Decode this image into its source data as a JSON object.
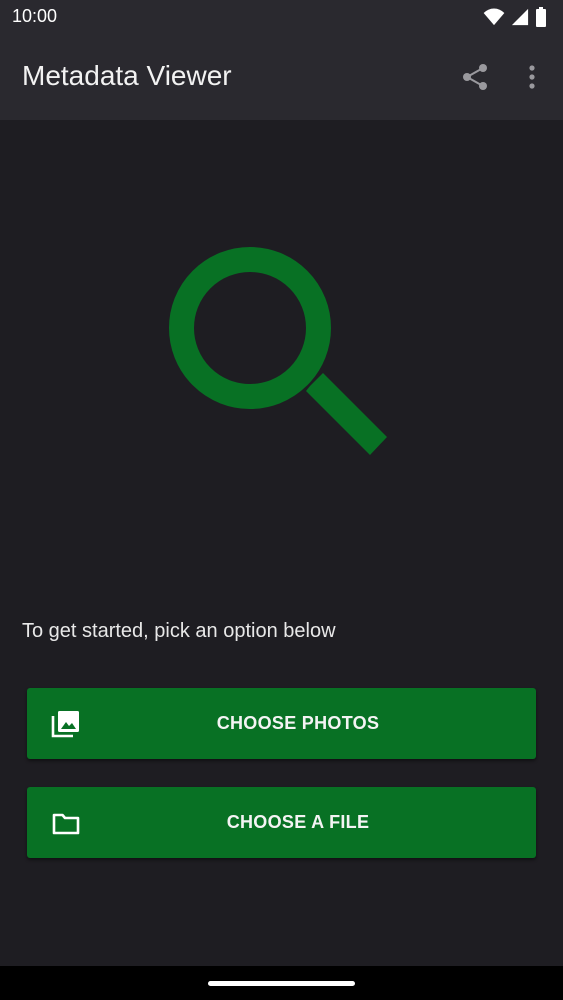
{
  "status_bar": {
    "time": "10:00",
    "icons": [
      "wifi-icon",
      "cellular-signal-icon",
      "battery-icon"
    ]
  },
  "app_bar": {
    "title": "Metadata Viewer",
    "actions": [
      "share-icon",
      "more-vert-icon"
    ]
  },
  "hero": {
    "icon": "search-icon",
    "color": "#087124"
  },
  "main": {
    "prompt": "To get started, pick an option below",
    "buttons": [
      {
        "label": "CHOOSE PHOTOS",
        "icon": "photo-library-icon"
      },
      {
        "label": "CHOOSE A FILE",
        "icon": "folder-icon"
      }
    ]
  },
  "colors": {
    "background": "#1e1d22",
    "app_bar": "#2a292f",
    "accent": "#087124"
  }
}
